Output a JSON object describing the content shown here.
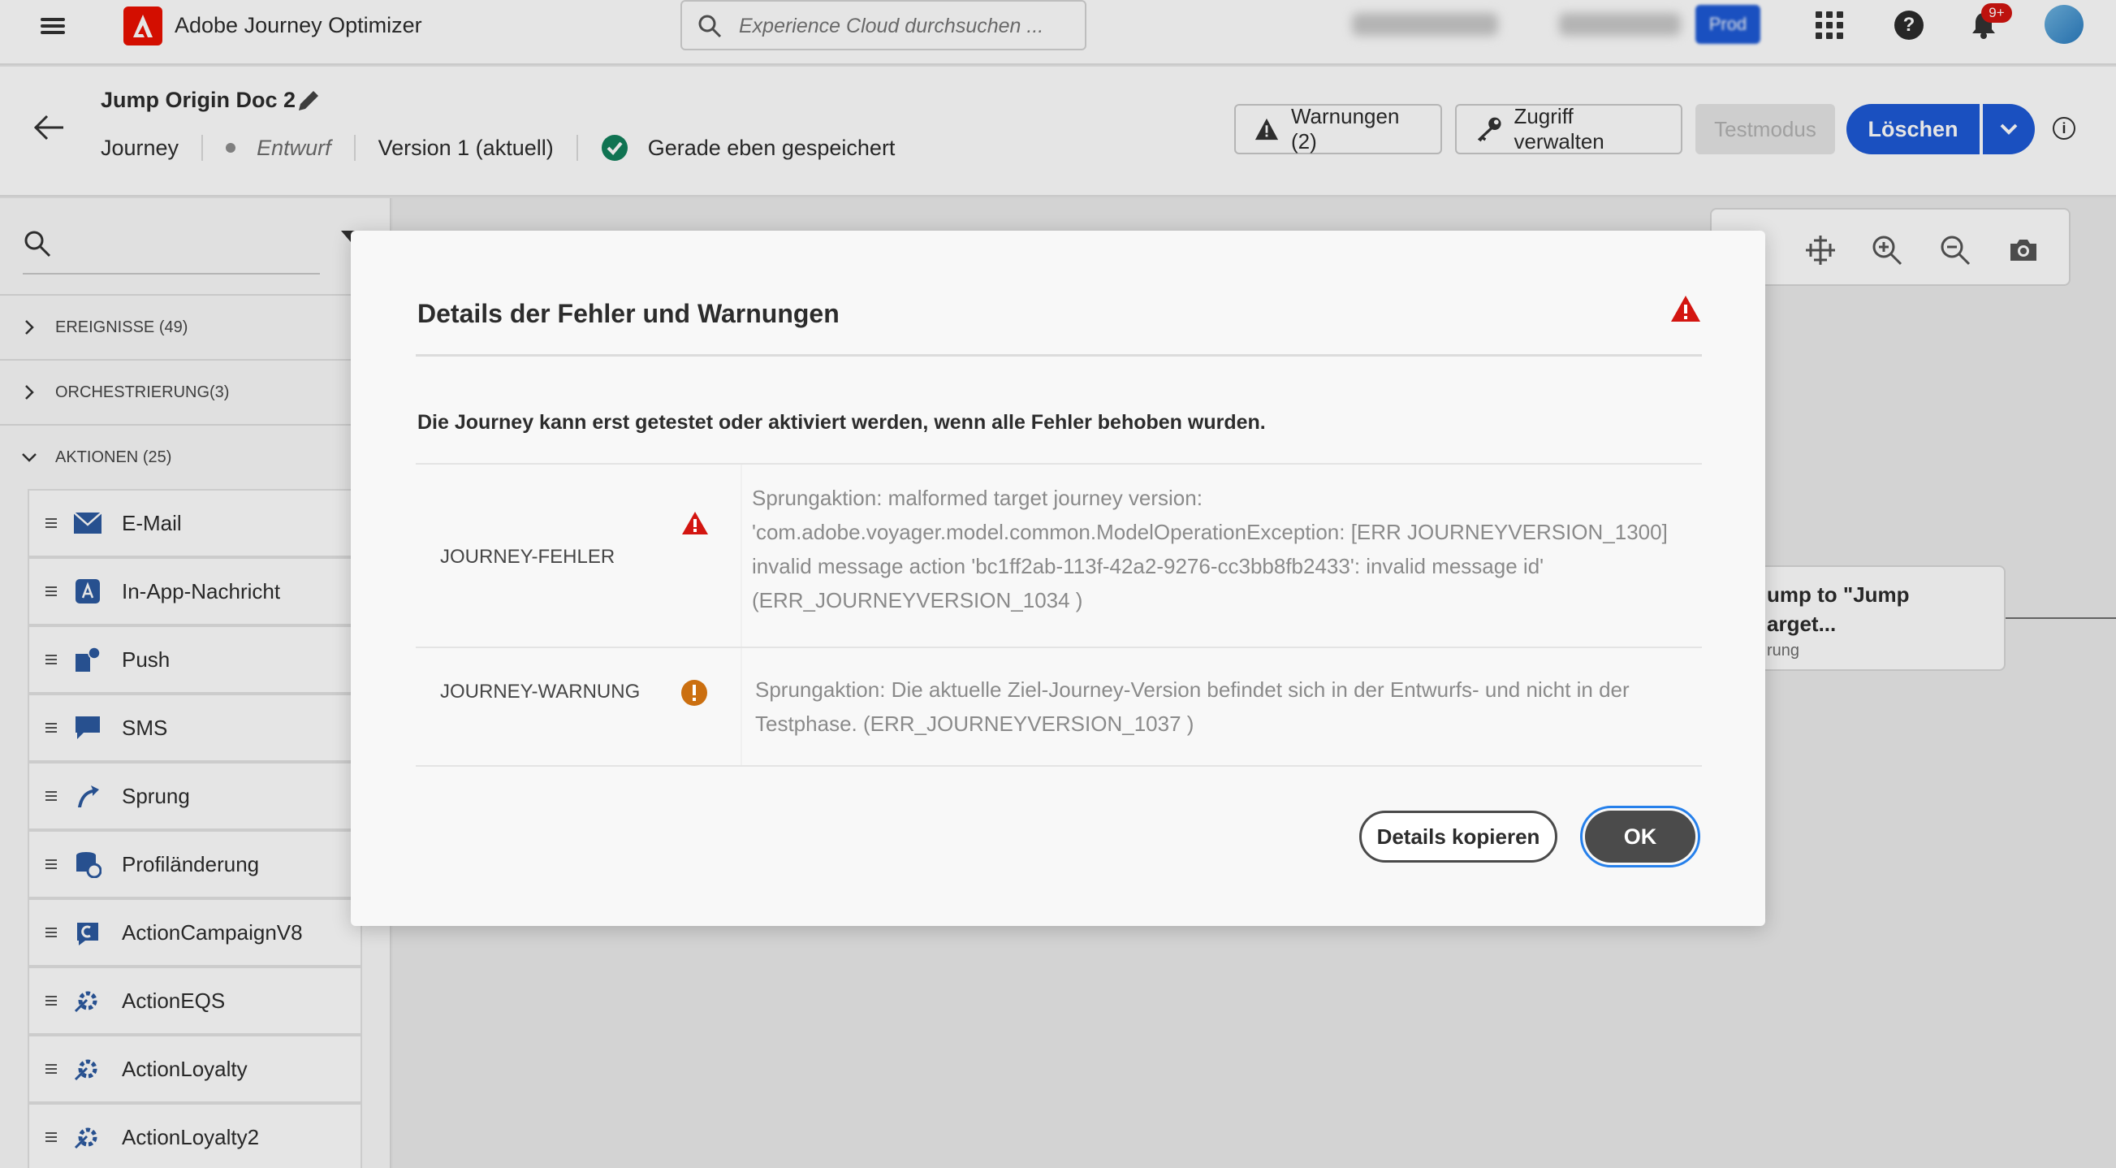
{
  "topbar": {
    "app_title": "Adobe Journey Optimizer",
    "search_placeholder": "Experience Cloud durchsuchen ...",
    "org_name_blurred": "CJM Prod NLD2",
    "sandbox_blurred": "Prod (NLD2)",
    "env_badge": "Prod",
    "notification_count": "9+"
  },
  "journey_header": {
    "title": "Jump Origin Doc 2",
    "type": "Journey",
    "status": "Entwurf",
    "version": "Version 1 (aktuell)",
    "save_status": "Gerade eben gespeichert",
    "warnings_button": "Warnungen (2)",
    "access_button": "Zugriff verwalten",
    "test_button": "Testmodus",
    "delete_button": "Löschen"
  },
  "left_panel": {
    "categories": [
      {
        "label": "EREIGNISSE",
        "count": "(49)"
      },
      {
        "label": "ORCHESTRIERUNG",
        "count": "(3)"
      },
      {
        "label": "AKTIONEN",
        "count": "(25)"
      }
    ],
    "actions": [
      {
        "label": "E-Mail",
        "icon": "email-icon"
      },
      {
        "label": "In-App-Nachricht",
        "icon": "in-app-icon"
      },
      {
        "label": "Push",
        "icon": "push-icon"
      },
      {
        "label": "SMS",
        "icon": "sms-icon"
      },
      {
        "label": "Sprung",
        "icon": "jump-icon"
      },
      {
        "label": "Profiländerung",
        "icon": "profile-update-icon"
      },
      {
        "label": "ActionCampaignV8",
        "icon": "campaign-icon"
      },
      {
        "label": "ActionEQS",
        "icon": "custom-action-icon"
      },
      {
        "label": "ActionLoyalty",
        "icon": "custom-action-icon"
      },
      {
        "label": "ActionLoyalty2",
        "icon": "custom-action-icon"
      }
    ]
  },
  "canvas": {
    "node_title": "ump to \"Jump arget...",
    "node_subtitle": "rung"
  },
  "dialog": {
    "title": "Details der Fehler und Warnungen",
    "description": "Die Journey kann erst getestet oder aktiviert werden, wenn alle Fehler behoben wurden.",
    "rows": [
      {
        "label": "JOURNEY-FEHLER",
        "severity": "error",
        "message_lines": [
          "Sprungaktion: malformed target journey version:",
          "'com.adobe.voyager.model.common.ModelOperationException: [ERR JOURNEYVERSION_1300]",
          "invalid message action 'bc1ff2ab-113f-42a2-9276-cc3bb8fb2433': invalid message id'",
          "(ERR_JOURNEYVERSION_1034 )"
        ]
      },
      {
        "label": "JOURNEY-WARNUNG",
        "severity": "warning",
        "message_lines": [
          "Sprungaktion: Die aktuelle Ziel-Journey-Version befindet sich in der Entwurfs- und nicht in der",
          "Testphase. (ERR_JOURNEYVERSION_1037 )"
        ]
      }
    ],
    "copy_button": "Details kopieren",
    "ok_button": "OK"
  },
  "colors": {
    "accent_blue": "#1e5ad6",
    "error_red": "#d31510",
    "warning_orange": "#e68619",
    "success_green": "#12805c"
  }
}
